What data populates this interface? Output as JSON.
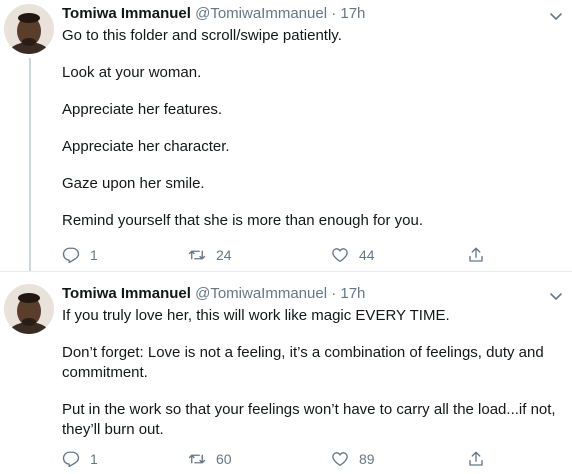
{
  "tweets": [
    {
      "author_name": "Tomiwa Immanuel",
      "handle": "@TomiwaImmanuel",
      "separator": "·",
      "time": "17h",
      "paragraphs": [
        "Go to this folder and scroll/swipe patiently.",
        "Look at your woman.",
        "Appreciate her features.",
        "Appreciate her character.",
        "Gaze upon her smile.",
        "Remind yourself that she is more than enough for you."
      ],
      "reply_count": "1",
      "retweet_count": "24",
      "like_count": "44"
    },
    {
      "author_name": "Tomiwa Immanuel",
      "handle": "@TomiwaImmanuel",
      "separator": "·",
      "time": "17h",
      "paragraphs": [
        "If you truly love her, this will work like magic EVERY TIME.",
        "Don’t forget: Love is not a feeling, it’s a combination of feelings, duty and commitment.",
        "Put in the work so that your feelings won’t have to carry all the load...if not, they’ll burn out."
      ],
      "reply_count": "1",
      "retweet_count": "60",
      "like_count": "89"
    }
  ],
  "icons": {
    "reply": "reply-icon",
    "retweet": "retweet-icon",
    "like": "heart-icon",
    "share": "share-icon",
    "more": "chevron-down-icon"
  },
  "colors": {
    "text": "#14171a",
    "secondary": "#657786",
    "divider": "#e6ecf0",
    "thread_line": "#ccd6dd"
  }
}
